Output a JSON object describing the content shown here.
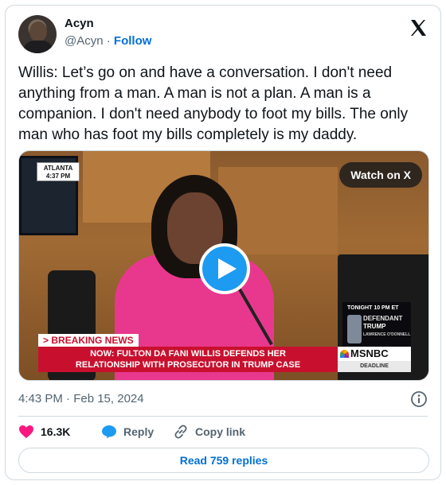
{
  "author": {
    "display_name": "Acyn",
    "handle": "@Acyn",
    "separator": "·",
    "follow_label": "Follow"
  },
  "tweet": {
    "text": "Willis: Let’s go on and have a conversation. I don't need anything from a man. A man is not a plan. A man is a companion. I don't need anybody to foot my bills. The only man who has foot my bills completely is my daddy.",
    "timestamp": "4:43 PM · Feb 15, 2024"
  },
  "media": {
    "watch_label": "Watch on X",
    "location_badge": "ATLANTA",
    "location_time": "4:37 PM",
    "breaking_label": "> BREAKING NEWS",
    "chyron_line1": "NOW: FULTON DA FANI WILLIS DEFENDS HER",
    "chyron_line2": "RELATIONSHIP WITH PROSECUTOR IN TRUMP CASE",
    "network": "MSNBC",
    "network_sub": "DEADLINE",
    "promo_time": "TONIGHT 10 PM ET",
    "promo_title1": "DEFENDANT",
    "promo_title2": "TRUMP",
    "promo_host": "LAWRENCE O'DONNELL"
  },
  "actions": {
    "like_count": "16.3K",
    "reply_label": "Reply",
    "copy_label": "Copy link"
  },
  "replies_button": "Read 759 replies",
  "colors": {
    "like": "#f91880",
    "reply": "#1d9bf0",
    "link": "#006fd6",
    "border": "#cfd9de",
    "muted": "#536471"
  },
  "icons": [
    "x-logo-icon",
    "play-icon",
    "info-icon",
    "heart-icon",
    "reply-bubble-icon",
    "link-icon"
  ]
}
